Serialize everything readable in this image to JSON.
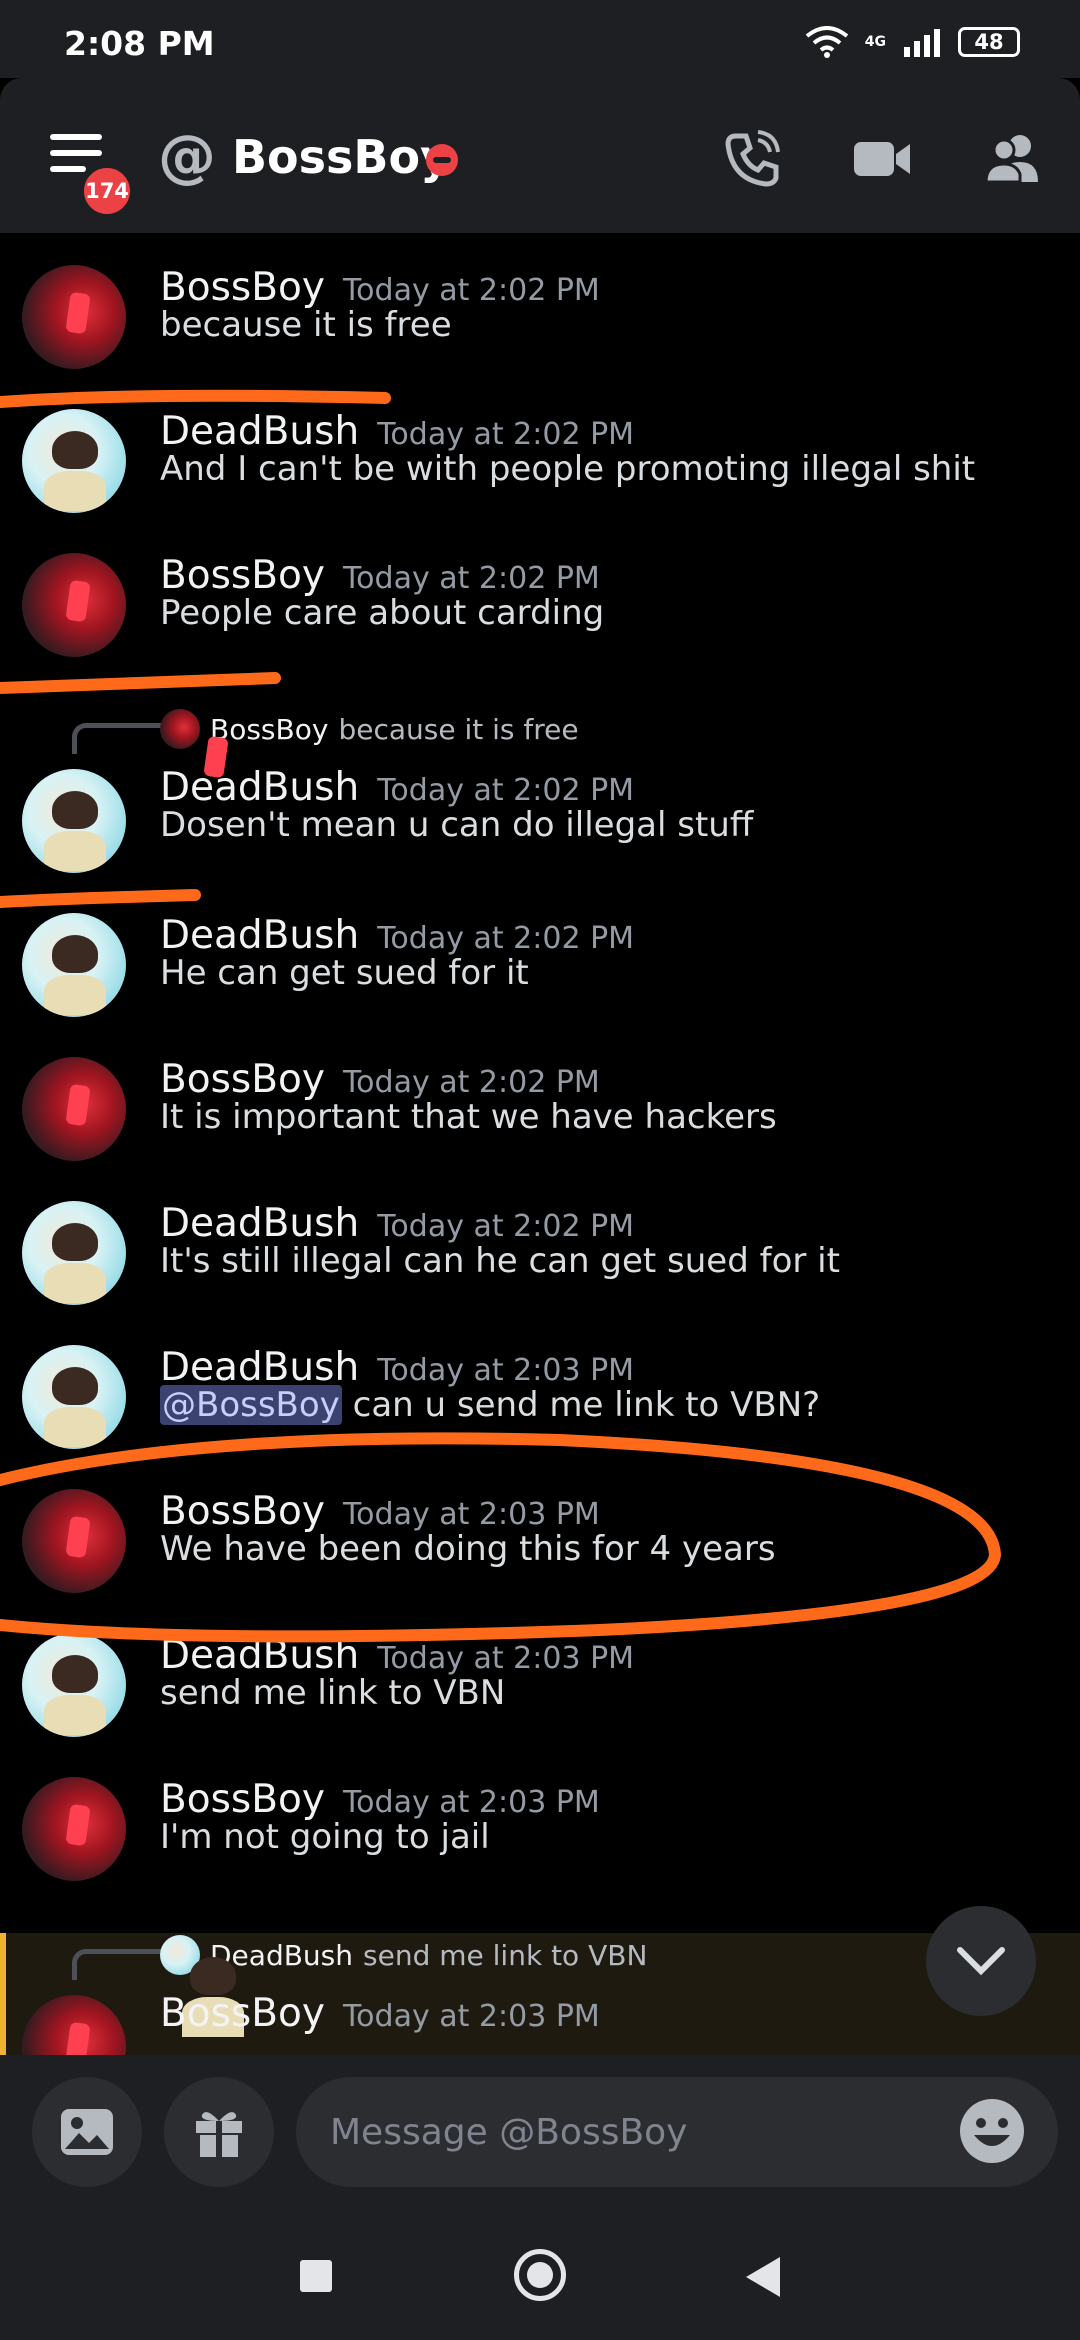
{
  "status_bar": {
    "time": "2:08 PM",
    "network": "4G",
    "battery": "48"
  },
  "header": {
    "unread_count": "174",
    "at_symbol": "@",
    "title": "BossBoy",
    "call_icon": "phone-call-icon",
    "video_icon": "video-camera-icon",
    "members_icon": "members-icon"
  },
  "messages": [
    {
      "author": "BossBoy",
      "timestamp": "Today at 2:02 PM",
      "text": "because it is free"
    },
    {
      "author": "DeadBush",
      "timestamp": "Today at 2:02 PM",
      "text": "And I can't be with people promoting illegal shit"
    },
    {
      "author": "BossBoy",
      "timestamp": "Today at 2:02 PM",
      "text": "People care about carding"
    },
    {
      "reply_to": {
        "author": "BossBoy",
        "text": "because it is free"
      },
      "author": "DeadBush",
      "timestamp": "Today at 2:02 PM",
      "text": "Dosen't mean u can do illegal stuff"
    },
    {
      "author": "DeadBush",
      "timestamp": "Today at 2:02 PM",
      "text": "He can get sued for it"
    },
    {
      "author": "BossBoy",
      "timestamp": "Today at 2:02 PM",
      "text": "It is important that we have hackers"
    },
    {
      "author": "DeadBush",
      "timestamp": "Today at 2:02 PM",
      "text": "It's still illegal can he can get sued for it"
    },
    {
      "author": "DeadBush",
      "timestamp": "Today at 2:03 PM",
      "mention": "@BossBoy",
      "text": " can u send me link to VBN?"
    },
    {
      "author": "BossBoy",
      "timestamp": "Today at 2:03 PM",
      "text": "We have been doing this for 4 years"
    },
    {
      "author": "DeadBush",
      "timestamp": "Today at 2:03 PM",
      "text": "send me link to VBN"
    },
    {
      "author": "BossBoy",
      "timestamp": "Today at 2:03 PM",
      "text": "I'm not going to jail"
    },
    {
      "reply_to": {
        "author": "DeadBush",
        "text": "send me link to VBN"
      },
      "author": "BossBoy",
      "timestamp": "Today at 2:03 PM",
      "text": ""
    }
  ],
  "composer": {
    "placeholder": "Message @BossBoy"
  },
  "colors": {
    "background": "#000000",
    "panel": "#1e1f22",
    "dnd_red": "#ed4245",
    "annotation": "#ff6a1a"
  }
}
